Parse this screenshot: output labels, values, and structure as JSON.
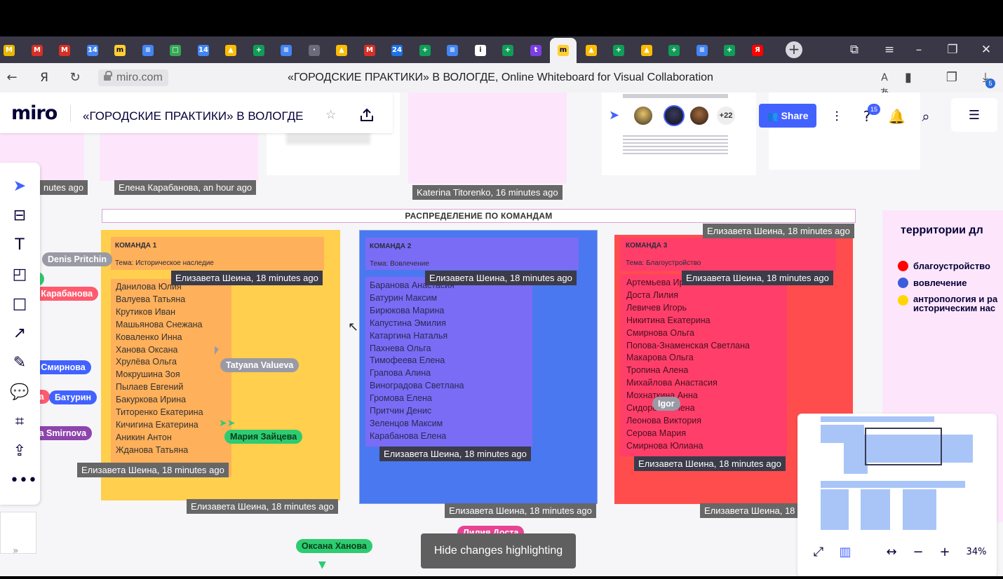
{
  "browser": {
    "tabs": [
      {
        "icon": "gmail-icon",
        "color": "#e6b800",
        "glyph": "M"
      },
      {
        "icon": "gmail-icon",
        "color": "#d93025",
        "glyph": "M"
      },
      {
        "icon": "gmail-icon",
        "color": "#d93025",
        "glyph": "M"
      },
      {
        "icon": "calendar-icon",
        "color": "#4285f4",
        "glyph": "14"
      },
      {
        "icon": "miro-icon",
        "color": "#ffd02f",
        "glyph": "m"
      },
      {
        "icon": "docs-icon",
        "color": "#4285f4",
        "glyph": "≡"
      },
      {
        "icon": "sheets-square-icon",
        "color": "#34a853",
        "glyph": "□"
      },
      {
        "icon": "calendar-icon",
        "color": "#4285f4",
        "glyph": "14"
      },
      {
        "icon": "drive-icon",
        "color": "#fbbc04",
        "glyph": "▲"
      },
      {
        "icon": "sheets-icon",
        "color": "#0f9d58",
        "glyph": "+"
      },
      {
        "icon": "docs-icon",
        "color": "#4285f4",
        "glyph": "≡"
      },
      {
        "icon": "web-icon",
        "color": "#6b6b7b",
        "glyph": "·"
      },
      {
        "icon": "drive-icon",
        "color": "#fbbc04",
        "glyph": "▲"
      },
      {
        "icon": "gmail-icon",
        "color": "#d93025",
        "glyph": "M"
      },
      {
        "icon": "clock-24-icon",
        "color": "#1a73e8",
        "glyph": "24"
      },
      {
        "icon": "sheets-icon",
        "color": "#0f9d58",
        "glyph": "+"
      },
      {
        "icon": "docs-icon",
        "color": "#4285f4",
        "glyph": "≡"
      },
      {
        "icon": "info-icon",
        "color": "#ffffff",
        "glyph": "i"
      },
      {
        "icon": "sheets-icon",
        "color": "#0f9d58",
        "glyph": "+"
      },
      {
        "icon": "tilda-icon",
        "color": "#7b3fe4",
        "glyph": "t"
      },
      {
        "icon": "miro-icon",
        "color": "#ffd02f",
        "glyph": "m",
        "active": true
      },
      {
        "icon": "drive-icon",
        "color": "#fbbc04",
        "glyph": "▲"
      },
      {
        "icon": "sheets-icon",
        "color": "#0f9d58",
        "glyph": "+"
      },
      {
        "icon": "drive-icon",
        "color": "#fbbc04",
        "glyph": "▲"
      },
      {
        "icon": "sheets-icon",
        "color": "#0f9d58",
        "glyph": "+"
      },
      {
        "icon": "docs-icon",
        "color": "#4285f4",
        "glyph": "≡"
      },
      {
        "icon": "sheets-icon",
        "color": "#0f9d58",
        "glyph": "+"
      },
      {
        "icon": "yandex-icon",
        "color": "#ff0000",
        "glyph": "Я"
      }
    ],
    "url": "miro.com",
    "page_title": "«ГОРОДСКИЕ ПРАКТИКИ» В ВОЛОГДЕ, Online Whiteboard for Visual Collaboration",
    "yandex_glyph": "Я",
    "downloads_badge": "5"
  },
  "miro": {
    "logo": "miro",
    "board_name": "«ГОРОДСКИЕ ПРАКТИКИ» В ВОЛОГДЕ",
    "extra_collaborators": "+22",
    "share_label": "Share",
    "help_badge": "15",
    "section_title": "РАСПРЕДЕЛЕНИЕ ПО КОМАНДАМ",
    "teams": [
      {
        "title": "КОМАНДА 1",
        "theme": "Тема: Историческое наследие",
        "members": [
          "Данилова Юлия",
          "Валуева Татьяна",
          "Крутиков Иван",
          "Машьянова Снежана",
          "Коваленко Инна",
          "Ханова Оксана",
          "Хрулёва Ольга",
          "Мокрушина Зоя",
          "Пылаев Евгений",
          "Бакуркова Ирина",
          "Титоренко Екатерина",
          "Кичигина Екатерина",
          "Аникин Антон",
          "Жданова Татьяна"
        ]
      },
      {
        "title": "КОМАНДА 2",
        "theme": "Тема: Вовлечение",
        "members": [
          "Баранова Анастасия",
          "Батурин Максим",
          "Бирюкова Марина",
          "Капустина Эмилия",
          "Катаргина Наталья",
          "Пахнева Ольга",
          "Тимофеева Елена",
          "Грапова Алина",
          "Виноградова Светлана",
          "Громова Елена",
          "Притчин Денис",
          "Зеленцов Максим",
          "Карабанова Елена"
        ]
      },
      {
        "title": "КОМАНДА 3",
        "theme": "Тема: Благоустройство",
        "members": [
          "Артемьева Ирина",
          "Доста Лилия",
          "Левичев Игорь",
          "Никитина Екатерина",
          "Смирнова Ольга",
          "Попова-Знаменская Светлана",
          "Макарова Ольга",
          "Тропина Алена",
          "Михайлова Анастасия",
          "Мохнаткина Анна",
          "Сидорова Елена",
          "Леонова Виктория",
          "Серова Мария",
          "Смирнова Юлиана"
        ]
      }
    ],
    "stamps": {
      "s1": "nutes ago",
      "s2": "Елена Карабанова, an hour ago",
      "s3": "Katerina Titorenko, 16 minutes ago",
      "s4": "Елизавета Шеина, 18 minutes ago",
      "s5": "Елизавета Шеина, 18 minutes ago",
      "s6": "Елизавета Шеина, 18 minutes ago",
      "s7": "Елизавета Шеина, 18 minutes ago",
      "s8": "Елизавета Шеина, 18 minutes ago",
      "s9": "Елизавета Шеина, 18 minutes ago",
      "s10": "Елизавета Шеина, 18 minutes ago",
      "s11": "Елизавета Шеина, 18 minutes ago",
      "s12": "Елизавета Шеина, 18 minutes ago",
      "s13": "Елизавета Шеина, 18 minutes ago",
      "s14": "Елизавета Шеина, 18 minutes ago",
      "s15": "Елизавета Шеина, 18 minutes ago"
    },
    "cursors": {
      "c1": "Denis Pritchin",
      "c2": "а",
      "c3": "а Карабанова",
      "c4": "а Смирнова",
      "c5": "ga",
      "c6": "Батурин",
      "c7": "na Smirnova",
      "c8": "Tatyana Valueva",
      "c9": "Мария Зайцева",
      "c10": "Igor",
      "c11": "Лилия Доста",
      "c12": "Оксана Ханова"
    },
    "legend": {
      "title": "территории дл",
      "items": [
        {
          "label": "благоустройство",
          "color": "#ff0000"
        },
        {
          "label": "вовлечение",
          "color": "#3b5ddd"
        },
        {
          "label": "антропология и ра",
          "label2": "историческим нас",
          "color": "#ffd600"
        }
      ]
    },
    "hide_changes_label": "Hide changes highlighting",
    "zoom_level": "34%",
    "colors": {
      "accent": "#4262ff",
      "team1": "#ffcf4d",
      "team2": "#4a78f0",
      "team3": "#ff4d4d"
    }
  }
}
